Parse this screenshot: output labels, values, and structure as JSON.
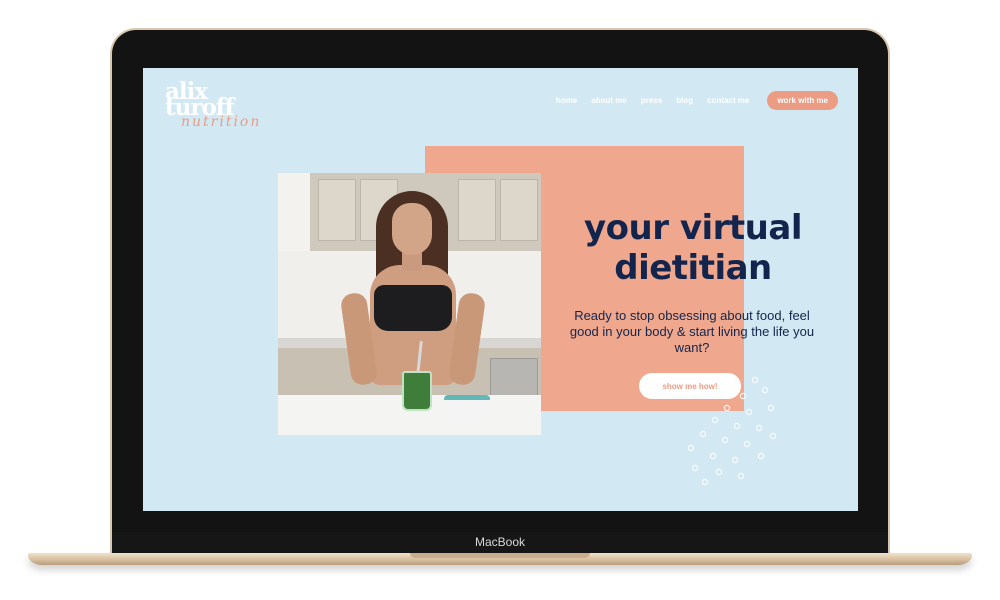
{
  "device": {
    "label": "MacBook"
  },
  "site": {
    "logo": {
      "line1": "alix",
      "line2": "turoff",
      "script": "nutrition"
    },
    "nav": {
      "links": [
        "home",
        "about me",
        "press",
        "blog",
        "contact me"
      ],
      "cta": "work with me"
    },
    "hero": {
      "headline_line1": "your virtual",
      "headline_line2": "dietitian",
      "subcopy": "Ready to stop obsessing about food, feel good in your body & start living the life you want?",
      "cta": "show me how!"
    }
  },
  "colors": {
    "screen_bg": "#d2e8f3",
    "salmon": "#efa88d",
    "accent": "#ec9c83",
    "navy_text": "#14254d"
  }
}
